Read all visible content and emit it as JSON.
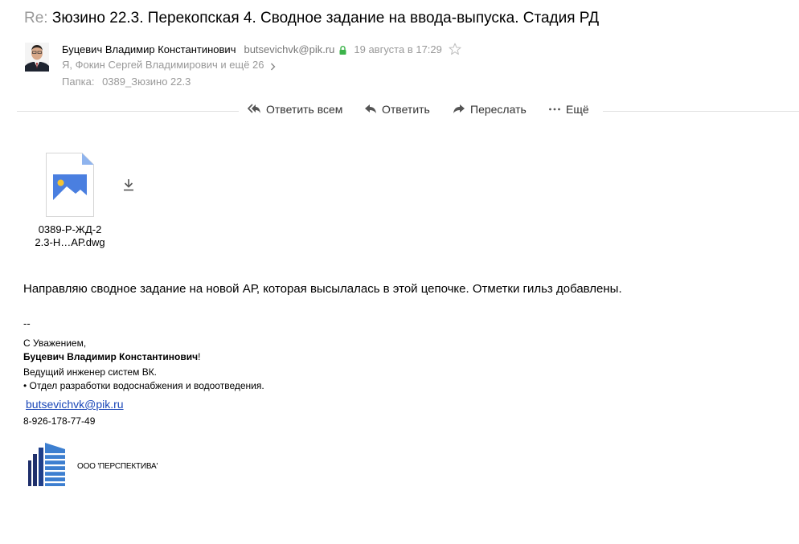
{
  "subject": {
    "prefix": "Re:",
    "text": "Зюзино 22.3. Перекопская 4. Сводное задание на ввода-выпуска. Стадия РД"
  },
  "sender": {
    "name": "Буцевич Владимир Константинович",
    "email": "butsevichvk@pik.ru",
    "date": "19 августа в 17:29"
  },
  "recipients": "Я, Фокин Сергей Владимирович и ещё 26",
  "folder": {
    "label": "Папка:",
    "name": "0389_Зюзино 22.3"
  },
  "actions": {
    "reply_all": "Ответить всем",
    "reply": "Ответить",
    "forward": "Переслать",
    "more": "Ещё"
  },
  "attachment": {
    "line1": "0389-Р-ЖД-2",
    "line2": "2.3-Н…АР.dwg"
  },
  "body": "Направляю сводное задание на новой АР, которая высылалась в этой цепочке. Отметки гильз добавлены.",
  "signature": {
    "dash": "--",
    "regards": "С Уважением,",
    "name": "Буцевич Владимир Константинович",
    "exclamation": "!",
    "position": "Ведущий инженер систем ВК.",
    "department": "• Отдел разработки водоснабжения и водоотведения.",
    "email": "butsevichvk@pik.ru",
    "phone": "8-926-178-77-49",
    "company": "ООО 'ПЕРСПЕКТИВА'"
  },
  "colors": {
    "link": "#1a47b8",
    "muted": "#999999",
    "lock": "#3bb34a",
    "logo_dark": "#1f2f6b",
    "logo_light": "#3d7fd0",
    "file_blue": "#4a7fe0"
  }
}
